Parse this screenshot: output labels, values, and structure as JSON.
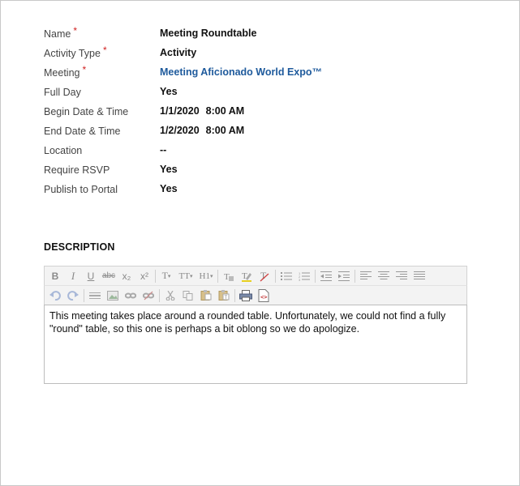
{
  "fields": [
    {
      "label": "Name",
      "required": "*",
      "value": "Meeting Roundtable"
    },
    {
      "label": "Activity Type",
      "required": "*",
      "value": "Activity"
    },
    {
      "label": "Meeting",
      "required": "*",
      "value": "Meeting Aficionado World Expo™"
    },
    {
      "label": "Full Day",
      "value": "Yes"
    },
    {
      "label": "Begin Date & Time",
      "date": "1/1/2020",
      "time": "8:00 AM"
    },
    {
      "label": "End Date & Time",
      "date": "1/2/2020",
      "time": "8:00 AM"
    },
    {
      "label": "Location",
      "value": "--"
    },
    {
      "label": "Require RSVP",
      "value": "Yes"
    },
    {
      "label": "Publish to Portal",
      "value": "Yes"
    }
  ],
  "description": {
    "title": "DESCRIPTION",
    "content": "This meeting takes place around a rounded table. Unfortunately, we could not find a fully \"round\" table, so this one is perhaps a bit oblong so we do apologize."
  },
  "toolbar": {
    "bold": "B",
    "italic": "I",
    "underline": "U",
    "strikethrough": "abc",
    "subscript": "x₂",
    "superscript": "x²",
    "font": "T",
    "font_size": "TT",
    "heading": "H1"
  },
  "colors": {
    "link": "#1e5a9c",
    "required": "#d02020",
    "toolbar_bg": "#f3f3f3"
  }
}
